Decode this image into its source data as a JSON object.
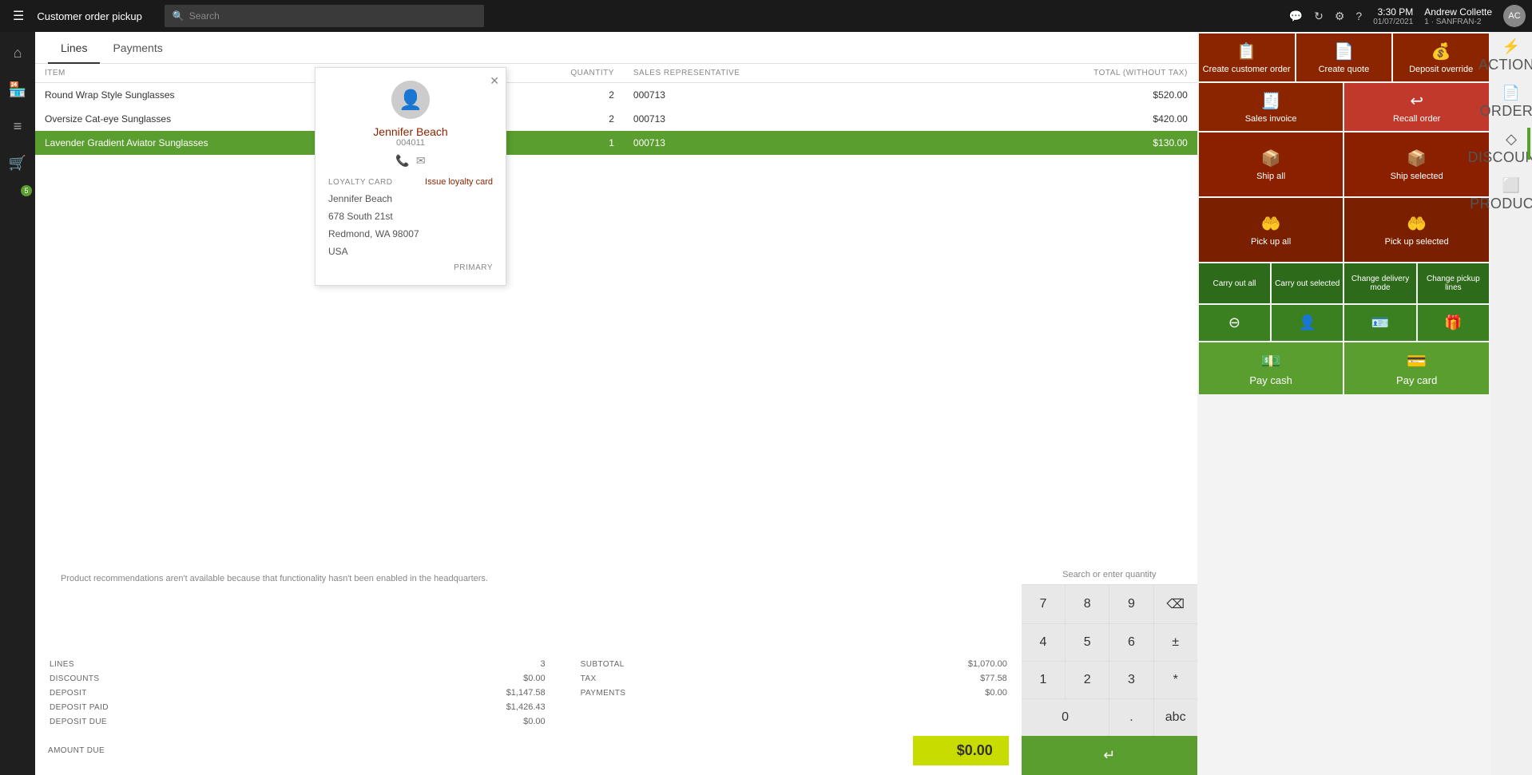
{
  "topbar": {
    "hamburger": "☰",
    "title": "Customer order pickup",
    "search_placeholder": "Search",
    "time": "3:30 PM",
    "date": "01/07/2021",
    "store": "1 · SANFRAN-2",
    "username": "Andrew Collette",
    "icons": {
      "chat": "💬",
      "refresh": "↻",
      "settings": "⚙",
      "help": "?"
    }
  },
  "sidebar": {
    "items": [
      {
        "id": "home",
        "icon": "⌂",
        "label": "Home"
      },
      {
        "id": "store",
        "icon": "🏪",
        "label": "Store"
      },
      {
        "id": "menu",
        "icon": "≡",
        "label": "Menu"
      },
      {
        "id": "cart",
        "icon": "🛒",
        "label": "Cart",
        "active": true
      },
      {
        "id": "badge",
        "icon": "5",
        "label": "Badge"
      }
    ]
  },
  "tabs": {
    "items": [
      {
        "id": "lines",
        "label": "Lines",
        "active": true
      },
      {
        "id": "payments",
        "label": "Payments",
        "active": false
      }
    ]
  },
  "table": {
    "headers": [
      {
        "id": "item",
        "label": "ITEM"
      },
      {
        "id": "quantity",
        "label": "QUANTITY"
      },
      {
        "id": "sales_rep",
        "label": "SALES REPRESENTATIVE"
      },
      {
        "id": "total",
        "label": "TOTAL (WITHOUT TAX)"
      }
    ],
    "rows": [
      {
        "item": "Round Wrap Style Sunglasses",
        "quantity": "2",
        "sales_rep": "000713",
        "total": "$520.00",
        "selected": false
      },
      {
        "item": "Oversize Cat-eye Sunglasses",
        "quantity": "2",
        "sales_rep": "000713",
        "total": "$420.00",
        "selected": false
      },
      {
        "item": "Lavender Gradient Aviator Sunglasses",
        "quantity": "1",
        "sales_rep": "000713",
        "total": "$130.00",
        "selected": true
      }
    ]
  },
  "customer": {
    "name": "Jennifer Beach",
    "id": "004011",
    "loyalty_label": "LOYALTY CARD",
    "loyalty_action": "Issue loyalty card",
    "loyalty_value": "Jennifer Beach",
    "address_line1": "678 South 21st",
    "address_line2": "Redmond, WA 98007",
    "address_line3": "USA",
    "primary_label": "PRIMARY"
  },
  "recommendation_text": "Product recommendations aren't available because that functionality hasn't been enabled in the headquarters.",
  "numpad": {
    "search_placeholder": "Search or enter quantity",
    "buttons": [
      "7",
      "8",
      "9",
      "⌫",
      "4",
      "5",
      "6",
      "±",
      "1",
      "2",
      "3",
      "*",
      "0",
      ".",
      "abc",
      "↵"
    ]
  },
  "summary": {
    "lines_label": "LINES",
    "lines_value": "3",
    "subtotal_label": "SUBTOTAL",
    "subtotal_value": "$1,070.00",
    "discounts_label": "DISCOUNTS",
    "discounts_value": "$0.00",
    "tax_label": "TAX",
    "tax_value": "$77.58",
    "deposit_label": "DEPOSIT",
    "deposit_value": "$1,147.58",
    "payments_label": "PAYMENTS",
    "payments_value": "$0.00",
    "deposit_paid_label": "DEPOSIT PAID",
    "deposit_paid_value": "$1,426.43",
    "deposit_due_label": "DEPOSIT DUE",
    "deposit_due_value": "$0.00",
    "amount_due_label": "AMOUNT DUE",
    "amount_due_value": "$0.00"
  },
  "actions": {
    "side_icons": [
      {
        "id": "actions",
        "label": "ACTIONS",
        "icon": "⚡"
      },
      {
        "id": "orders",
        "label": "ORDERS",
        "icon": "📄",
        "active": true
      },
      {
        "id": "discounts",
        "label": "DISCOUNTS",
        "icon": "◇"
      },
      {
        "id": "products",
        "label": "PRODUCTS",
        "icon": "⬜"
      }
    ],
    "buttons_row1": [
      {
        "id": "create-customer-order",
        "label": "Create customer order",
        "icon": "📋",
        "color": "dark-red"
      },
      {
        "id": "create-quote",
        "label": "Create quote",
        "icon": "📄",
        "color": "dark-red"
      },
      {
        "id": "deposit-override",
        "label": "Deposit override",
        "icon": "💰",
        "color": "dark-red"
      }
    ],
    "buttons_row2": [
      {
        "id": "sales-invoice",
        "label": "Sales invoice",
        "icon": "🧾",
        "color": "dark-red"
      },
      {
        "id": "recall-order",
        "label": "Recall order",
        "icon": "↩",
        "color": "dark-red"
      }
    ],
    "ship_all": "Ship all",
    "ship_selected": "Ship selected",
    "pick_up_all": "Pick up all",
    "pick_up_selected": "Pick up selected",
    "carry_out_all": "Carry out all",
    "carry_out_selected": "Carry out selected",
    "change_delivery_mode": "Change delivery mode",
    "change_pickup_lines": "Change pickup lines",
    "pay_cash": "Pay cash",
    "pay_card": "Pay card"
  }
}
